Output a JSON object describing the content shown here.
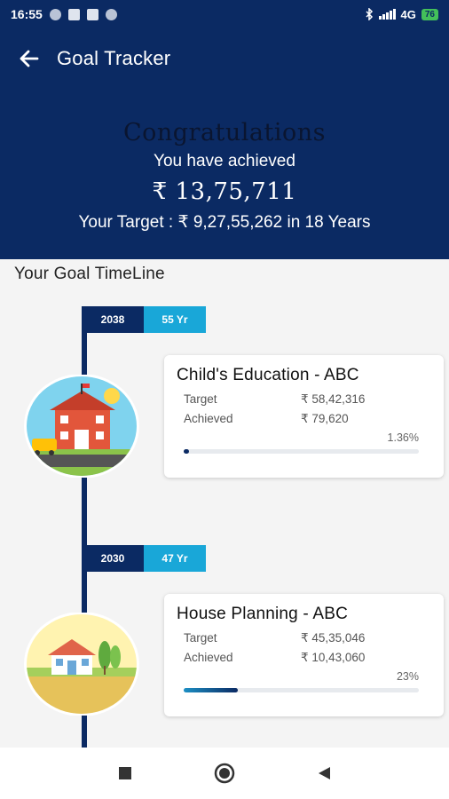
{
  "status_bar": {
    "time": "16:55",
    "network": "4G",
    "battery": "76"
  },
  "toolbar": {
    "title": "Goal Tracker"
  },
  "summary": {
    "congrats": "Congratulations",
    "achieved_label": "You have achieved",
    "achieved_amount": "₹ 13,75,711",
    "target_line": "Your Target : ₹ 9,27,55,262 in 18 Years"
  },
  "timeline": {
    "title": "Your Goal TimeLine",
    "goals": [
      {
        "year": "2038",
        "age": "55 Yr",
        "name": "Child's Education - ABC",
        "target_label": "Target",
        "target_value": "₹ 58,42,316",
        "achieved_label": "Achieved",
        "achieved_value": "₹ 79,620",
        "percent_text": "1.36%",
        "progress": 0.0136
      },
      {
        "year": "2030",
        "age": "47 Yr",
        "name": "House Planning  - ABC",
        "target_label": "Target",
        "target_value": "₹ 45,35,046",
        "achieved_label": "Achieved",
        "achieved_value": "₹ 10,43,060",
        "percent_text": "23%",
        "progress": 0.23
      }
    ]
  },
  "colors": {
    "primary": "#0b2a63",
    "accent": "#19a7d8",
    "progress_secondary": "#1c8fc4"
  },
  "icons": {
    "back": "arrow-left-icon",
    "goal_1": "school-icon",
    "goal_2": "house-icon",
    "nav_recents": "square-icon",
    "nav_home": "circle-icon",
    "nav_back": "triangle-back-icon"
  }
}
